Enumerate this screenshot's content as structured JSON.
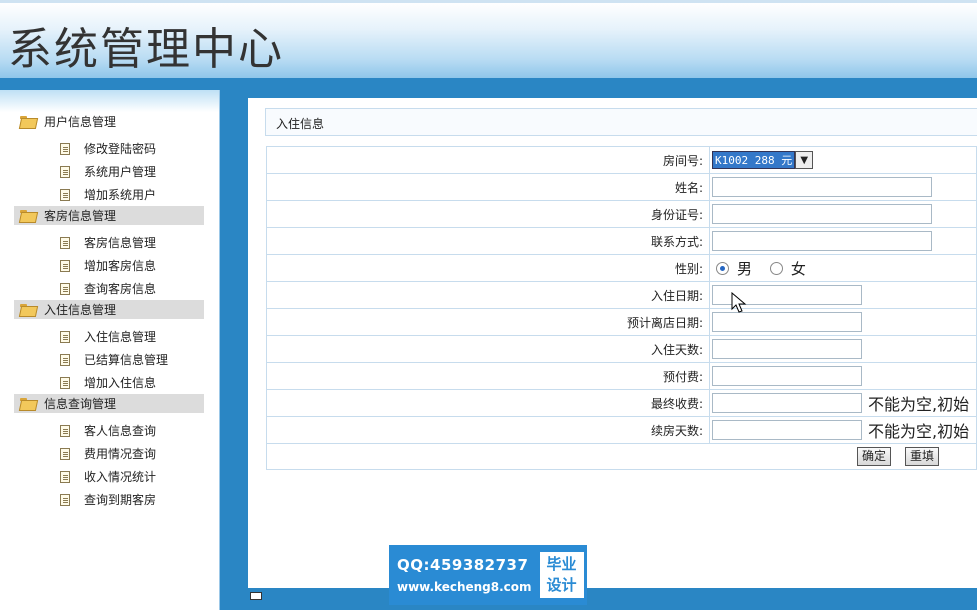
{
  "header": {
    "title": "系统管理中心"
  },
  "sidebar": {
    "groups": [
      {
        "label": "用户信息管理",
        "items": [
          "修改登陆密码",
          "系统用户管理",
          "增加系统用户"
        ]
      },
      {
        "label": "客房信息管理",
        "items": [
          "客房信息管理",
          "增加客房信息",
          "查询客房信息"
        ]
      },
      {
        "label": "入住信息管理",
        "items": [
          "入住信息管理",
          "已结算信息管理",
          "增加入住信息"
        ]
      },
      {
        "label": "信息查询管理",
        "items": [
          "客人信息查询",
          "费用情况查询",
          "收入情况统计",
          "查询到期客房"
        ]
      }
    ]
  },
  "main": {
    "panel_title": "入住信息",
    "form": {
      "room_label": "房间号:",
      "room_value": "K1002 288 元",
      "name_label": "姓名:",
      "id_label": "身份证号:",
      "contact_label": "联系方式:",
      "gender_label": "性别:",
      "gender_male": "男",
      "gender_female": "女",
      "checkin_label": "入住日期:",
      "checkout_label": "预计离店日期:",
      "days_label": "入住天数:",
      "prepay_label": "预付费:",
      "final_label": "最终收费:",
      "final_hint": "不能为空,初始",
      "extend_label": "续房天数:",
      "extend_hint": "不能为空,初始",
      "confirm_label": "确定",
      "reset_label": "重填"
    }
  },
  "watermark": {
    "qq": "QQ:459382737",
    "url": "www.kecheng8.com",
    "badge_line1": "毕业",
    "badge_line2": "设计"
  }
}
